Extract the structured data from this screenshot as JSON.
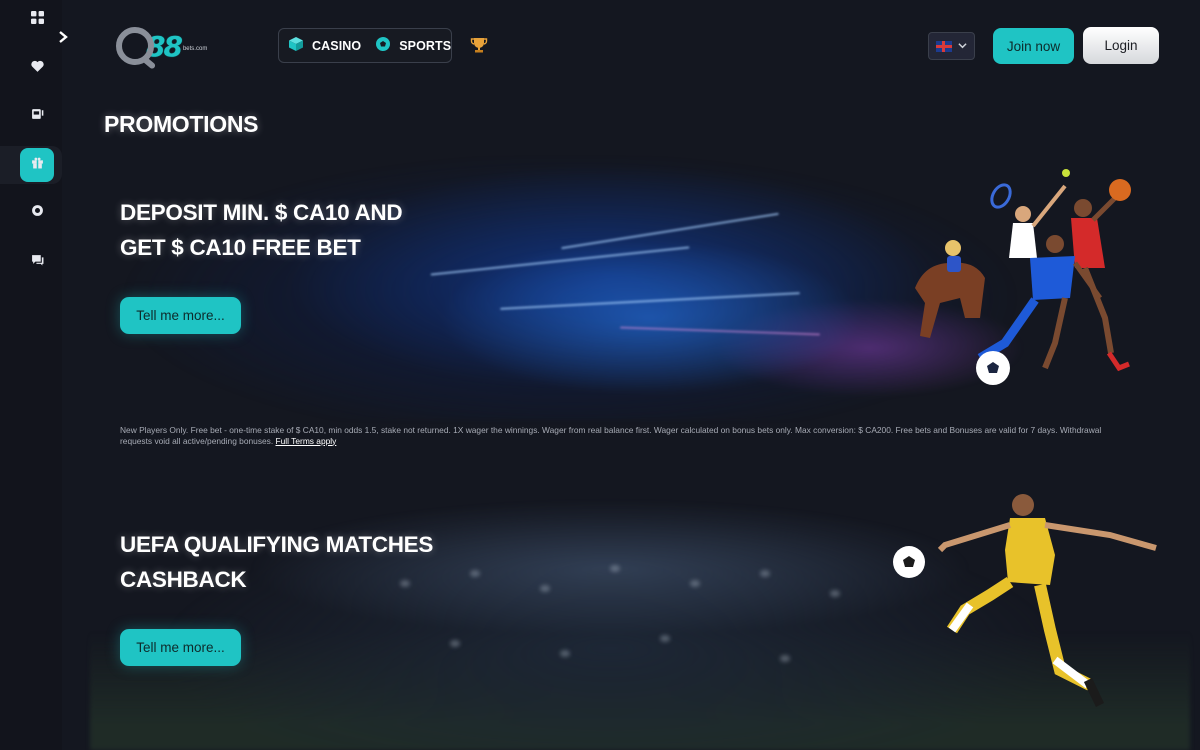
{
  "sidebar": {
    "items": [
      {
        "name": "dashboard",
        "icon": "grid-icon"
      },
      {
        "name": "favorites",
        "icon": "heart-icon"
      },
      {
        "name": "casino",
        "icon": "slot-machine-icon"
      },
      {
        "name": "promotions",
        "icon": "gift-icon",
        "active": true
      },
      {
        "name": "settings",
        "icon": "cog-icon"
      },
      {
        "name": "chat",
        "icon": "chat-icon"
      }
    ],
    "expand_icon": "chevron-right-icon",
    "active_color": "#1fc4c4"
  },
  "header": {
    "logo_suffix": "bets.com",
    "logo_main": "88",
    "nav": [
      {
        "label": "CASINO",
        "icon": "cube-icon"
      },
      {
        "label": "SPORTS",
        "icon": "soccer-ball-icon"
      }
    ],
    "trophy_icon": "trophy-icon",
    "language_icon": "uk-flag-icon",
    "join_label": "Join now",
    "login_label": "Login"
  },
  "page": {
    "title": "PROMOTIONS"
  },
  "promos": [
    {
      "headline_line1": "DEPOSIT MIN. $ CA10 AND",
      "headline_line2": "GET $ CA10 FREE BET",
      "cta": "Tell me more...",
      "terms": "New Players Only. Free bet - one-time stake of $ CA10, min odds 1.5, stake not returned. 1X wager the winnings. Wager from real balance first. Wager calculated on bonus bets only. Max conversion: $ CA200. Free bets and Bonuses are valid for 7 days. Withdrawal requests void all active/pending bonuses.",
      "terms_link": "Full Terms apply"
    },
    {
      "headline_line1": "UEFA QUALIFYING MATCHES",
      "headline_line2": "CASHBACK",
      "cta": "Tell me more..."
    }
  ],
  "colors": {
    "background": "#141720",
    "accent": "#1fc4c4"
  }
}
